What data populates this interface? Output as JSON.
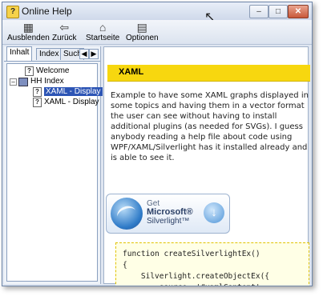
{
  "window": {
    "title": "Online Help"
  },
  "toolbar": {
    "hide_label": "Ausblenden",
    "back_label": "Zurück",
    "home_label": "Startseite",
    "options_label": "Optionen"
  },
  "sidebar": {
    "tabs": [
      {
        "label": "Inhalt",
        "active": true
      },
      {
        "label": "Index",
        "active": false
      },
      {
        "label": "Suche",
        "active": false
      }
    ],
    "tree": [
      {
        "label": "Welcome",
        "icon": "help-page-icon"
      },
      {
        "label": "HH Index",
        "icon": "book-icon",
        "expanded": true
      },
      {
        "label": "XAML - Display",
        "icon": "help-page-icon",
        "selected": true
      },
      {
        "label": "XAML - Display",
        "icon": "help-page-icon",
        "selected": false
      }
    ]
  },
  "content": {
    "heading": "XAML",
    "paragraph": "Example to have some XAML graphs displayed in some topics and having them in a vector format the user can see without having to install additional plugins (as needed for SVGs). I guess anybody reading a help file about code using WPF/XAML/Silverlight has it installed already and is able to see it.",
    "silverlight_badge": {
      "get": "Get",
      "microsoft": "Microsoft®",
      "silverlight": "Silverlight™"
    },
    "code": "function createSilverlightEx()\n{\n    Silverlight.createObjectEx({\n        source: '#xamlContent',"
  },
  "colors": {
    "heading_bg": "#f7d70f",
    "selection": "#2d55b5",
    "code_bg": "#ffffe6"
  }
}
